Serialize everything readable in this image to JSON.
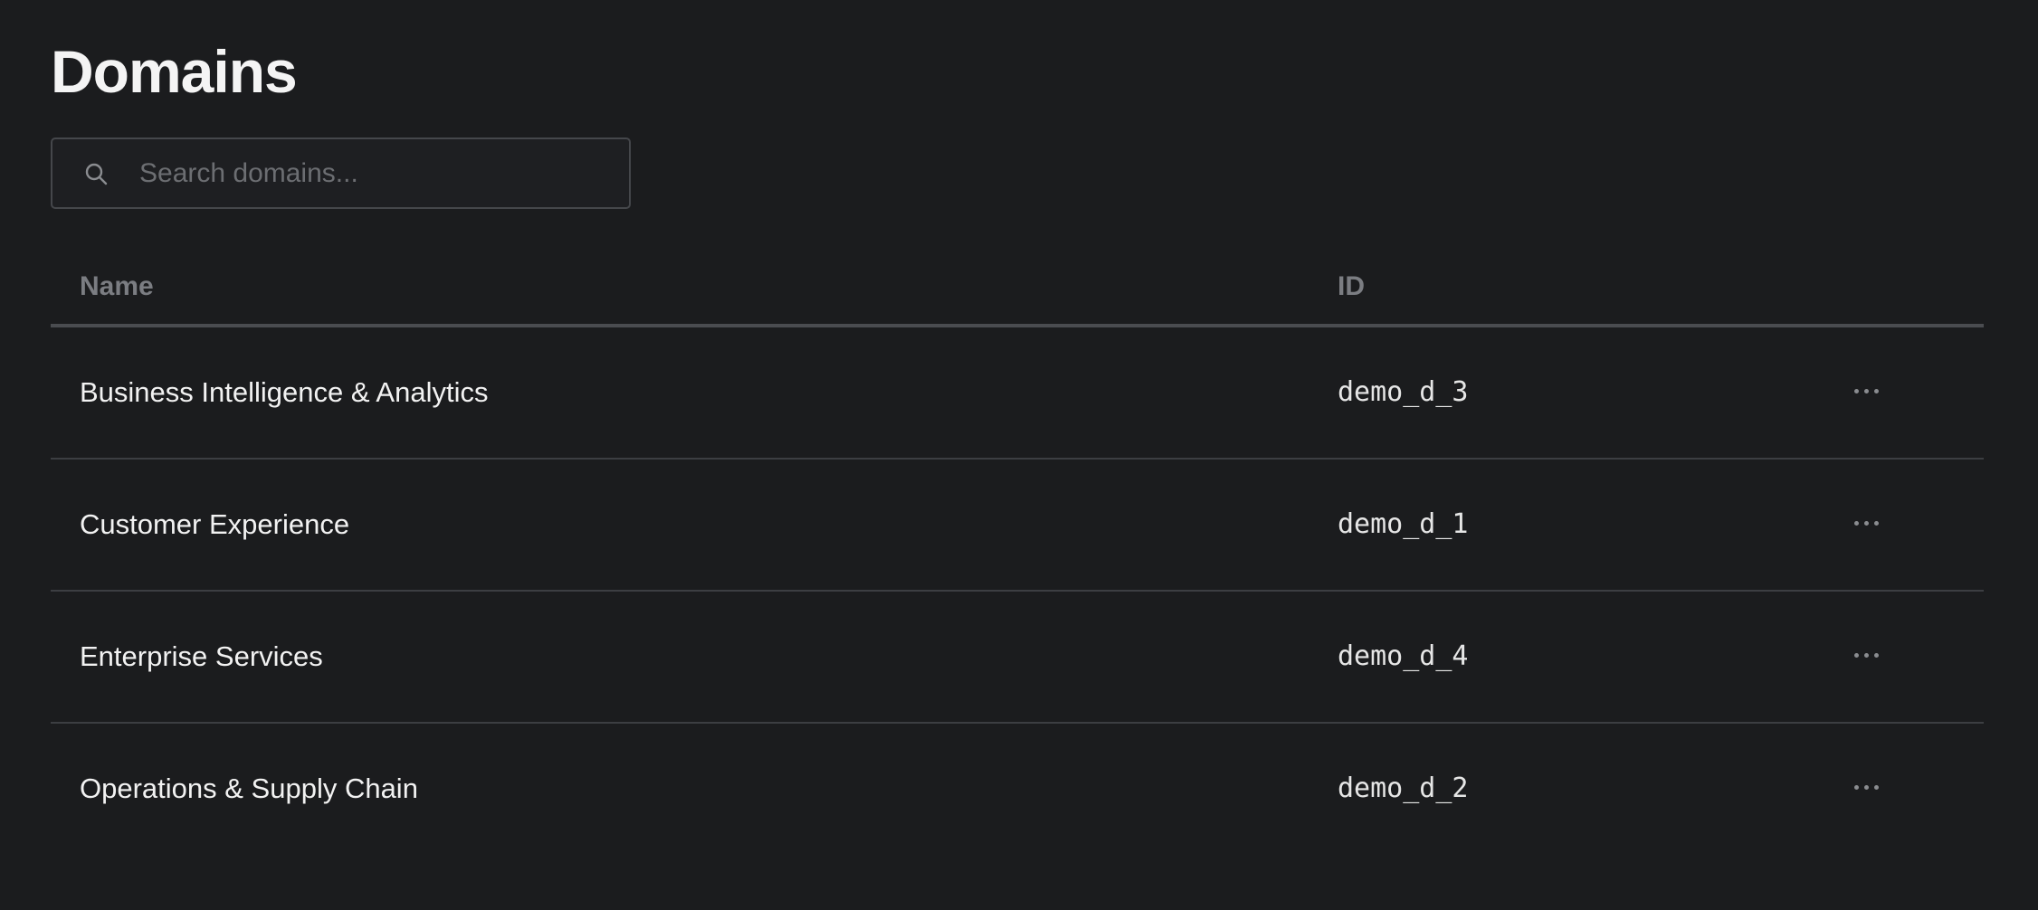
{
  "page": {
    "title": "Domains"
  },
  "search": {
    "placeholder": "Search domains...",
    "value": "",
    "icon": "search-icon"
  },
  "table": {
    "columns": [
      "Name",
      "ID"
    ],
    "rows": [
      {
        "name": "Business Intelligence & Analytics",
        "id": "demo_d_3"
      },
      {
        "name": "Customer Experience",
        "id": "demo_d_1"
      },
      {
        "name": "Enterprise Services",
        "id": "demo_d_4"
      },
      {
        "name": "Operations & Supply Chain",
        "id": "demo_d_2"
      }
    ],
    "row_action_icon": "more-horizontal-icon"
  },
  "colors": {
    "background": "#1b1c1e",
    "text": "#f2f2f2",
    "muted": "#7b7d82",
    "border": "#45474b"
  }
}
